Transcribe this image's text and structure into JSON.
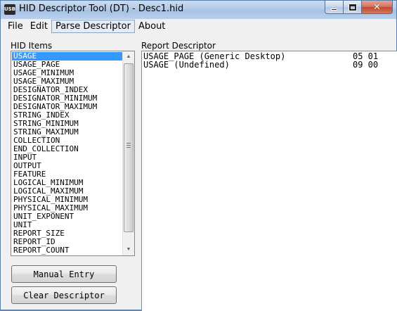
{
  "window": {
    "title": "HID Descriptor Tool (DT) - Desc1.hid",
    "icon_text": "USB",
    "buttons": [
      "minimize-icon",
      "maximize-icon",
      "close-icon"
    ]
  },
  "menu": {
    "items": [
      {
        "label": "File"
      },
      {
        "label": "Edit"
      },
      {
        "label": "Parse Descriptor"
      },
      {
        "label": "About"
      }
    ]
  },
  "hid_items": {
    "label": "HID Items",
    "selected": "USAGE",
    "items": [
      "USAGE",
      "USAGE_PAGE",
      "USAGE_MINIMUM",
      "USAGE_MAXIMUM",
      "DESIGNATOR_INDEX",
      "DESIGNATOR_MINIMUM",
      "DESIGNATOR_MAXIMUM",
      "STRING_INDEX",
      "STRING_MINIMUM",
      "STRING_MAXIMUM",
      "COLLECTION",
      "END_COLLECTION",
      "INPUT",
      "OUTPUT",
      "FEATURE",
      "LOGICAL_MINIMUM",
      "LOGICAL_MAXIMUM",
      "PHYSICAL_MINIMUM",
      "PHYSICAL_MAXIMUM",
      "UNIT_EXPONENT",
      "UNIT",
      "REPORT_SIZE",
      "REPORT_ID",
      "REPORT_COUNT"
    ]
  },
  "buttons": {
    "manual_entry": "Manual Entry",
    "clear_descriptor": "Clear Descriptor"
  },
  "report": {
    "label": "Report Descriptor",
    "rows": [
      {
        "item": "USAGE_PAGE (Generic Desktop)",
        "bytes": "05 01"
      },
      {
        "item": "USAGE (Undefined)",
        "bytes": "09 00"
      }
    ]
  }
}
